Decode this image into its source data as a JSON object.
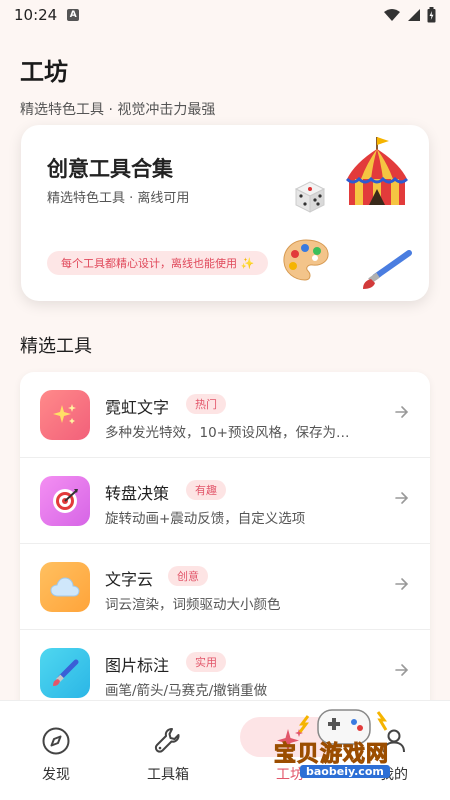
{
  "status_bar": {
    "time": "10:24",
    "a_badge": "A"
  },
  "header": {
    "title": "工坊",
    "subtitle": "精选特色工具 · 视觉冲击力最强"
  },
  "hero": {
    "title": "创意工具合集",
    "subtitle": "精选特色工具 · 离线可用",
    "chip": "每个工具都精心设计，离线也能使用 ✨"
  },
  "section": {
    "title": "精选工具"
  },
  "tools": [
    {
      "name": "霓虹文字",
      "tag": "热门",
      "desc": "多种发光特效，10+预设风格，保存为…",
      "icon": "sparkles-icon",
      "color_from": "#ff8a8a",
      "color_to": "#f2607a"
    },
    {
      "name": "转盘决策",
      "tag": "有趣",
      "desc": "旋转动画+震动反馈，自定义选项",
      "icon": "target-icon",
      "color_from": "#f48ff2",
      "color_to": "#d665e6"
    },
    {
      "name": "文字云",
      "tag": "创意",
      "desc": "词云渲染，词频驱动大小颜色",
      "icon": "cloud-icon",
      "color_from": "#ffc060",
      "color_to": "#ffa43a"
    },
    {
      "name": "图片标注",
      "tag": "实用",
      "desc": "画笔/箭头/马赛克/撤销重做",
      "icon": "brush-icon",
      "color_from": "#4fd7f0",
      "color_to": "#2bb6e6"
    }
  ],
  "nav": [
    {
      "label": "发现",
      "icon": "compass-icon"
    },
    {
      "label": "工具箱",
      "icon": "wrench-icon"
    },
    {
      "label": "工坊",
      "icon": "sparkle-icon"
    },
    {
      "label": "我的",
      "icon": "person-icon"
    }
  ],
  "watermark": {
    "text": "宝贝游戏网",
    "url": "baobeiy.com"
  },
  "colors": {
    "accent": "#e2566a",
    "background": "#fdf6f3"
  }
}
